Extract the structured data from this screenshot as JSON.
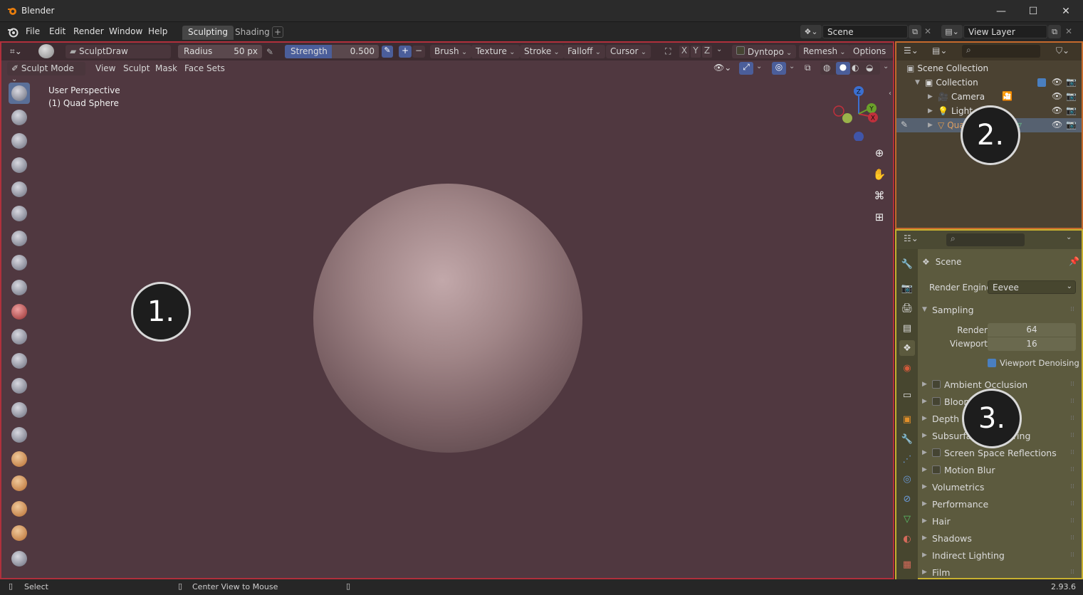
{
  "window": {
    "title": "Blender",
    "version": "2.93.6"
  },
  "menu": [
    "File",
    "Edit",
    "Render",
    "Window",
    "Help"
  ],
  "workspace_tabs": [
    {
      "label": "Sculpting",
      "active": true
    },
    {
      "label": "Shading",
      "active": false
    }
  ],
  "scene_field": "Scene",
  "view_layer_field": "View Layer",
  "viewport_header": {
    "brush_name": "SculptDraw",
    "radius_label": "Radius",
    "radius_value": "50 px",
    "strength_label": "Strength",
    "strength_value": "0.500",
    "menus": [
      "Brush",
      "Texture",
      "Stroke",
      "Falloff",
      "Cursor"
    ],
    "axes": [
      "X",
      "Y",
      "Z"
    ],
    "dyntopo": "Dyntopo",
    "remesh": "Remesh",
    "options": "Options"
  },
  "viewport_header2": {
    "mode": "Sculpt Mode",
    "menus": [
      "View",
      "Sculpt",
      "Mask",
      "Face Sets"
    ]
  },
  "viewport_info": {
    "line1": "User Perspective",
    "line2": "(1) Quad Sphere"
  },
  "gizmo_axes": {
    "x": "X",
    "y": "Y",
    "z": "Z"
  },
  "callouts": {
    "c1": "1.",
    "c2": "2.",
    "c3": "3."
  },
  "outliner": {
    "root": "Scene Collection",
    "items": [
      {
        "label": "Collection",
        "depth": 1
      },
      {
        "label": "Camera",
        "depth": 2
      },
      {
        "label": "Light",
        "depth": 2
      },
      {
        "label": "Quad Sphere",
        "depth": 2,
        "selected": true
      }
    ]
  },
  "properties": {
    "context": "Scene",
    "render_engine_label": "Render Engine",
    "render_engine_value": "Eevee",
    "sampling": "Sampling",
    "render_label": "Render",
    "render_value": "64",
    "viewport_label": "Viewport",
    "viewport_value": "16",
    "viewport_denoising": "Viewport Denoising",
    "panels": [
      {
        "label": "Ambient Occlusion",
        "checkbox": true
      },
      {
        "label": "Bloom",
        "checkbox": true
      },
      {
        "label": "Depth of Field",
        "checkbox": false
      },
      {
        "label": "Subsurface Scattering",
        "checkbox": false
      },
      {
        "label": "Screen Space Reflections",
        "checkbox": true
      },
      {
        "label": "Motion Blur",
        "checkbox": true
      },
      {
        "label": "Volumetrics",
        "checkbox": false
      },
      {
        "label": "Performance",
        "checkbox": false
      },
      {
        "label": "Hair",
        "checkbox": false
      },
      {
        "label": "Shadows",
        "checkbox": false
      },
      {
        "label": "Indirect Lighting",
        "checkbox": false
      },
      {
        "label": "Film",
        "checkbox": false
      }
    ]
  },
  "statusbar": {
    "select": "Select",
    "center": "Center View to Mouse"
  },
  "colors": {
    "viewport_bg": "#503840",
    "outliner_border": "#c56a2c",
    "props_border": "#c8b030",
    "viewport_border": "#b0303c",
    "active_blue": "#4b5e9a"
  }
}
